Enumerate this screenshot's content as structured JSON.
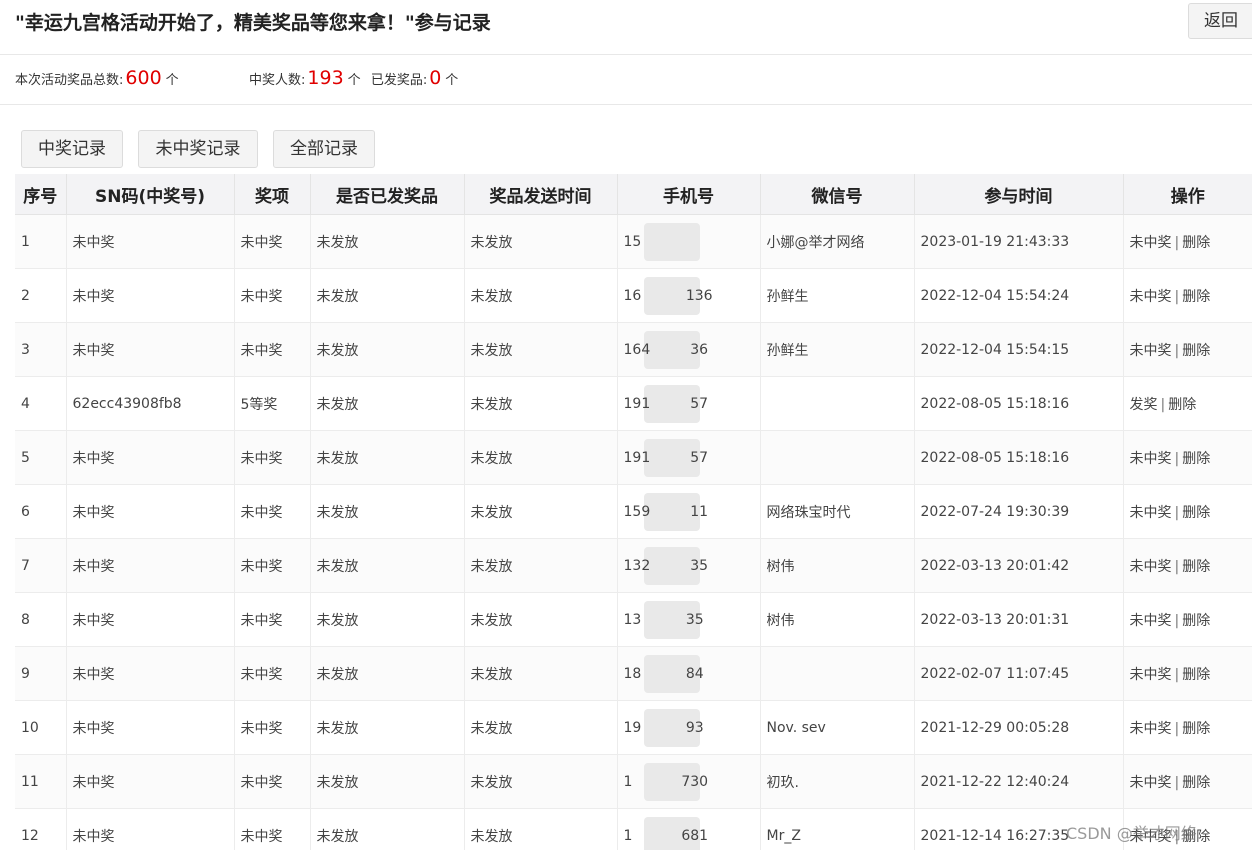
{
  "header": {
    "title": "\"幸运九宫格活动开始了，精美奖品等您来拿！\"参与记录",
    "back_label": "返回"
  },
  "stats": {
    "total_label": "本次活动奖品总数:",
    "total_value": "600",
    "unit": "个",
    "winners_label": "中奖人数:",
    "winners_value": "193",
    "issued_label": "已发奖品:",
    "issued_value": "0"
  },
  "tabs": [
    {
      "label": "中奖记录"
    },
    {
      "label": "未中奖记录"
    },
    {
      "label": "全部记录"
    }
  ],
  "table": {
    "headers": [
      "序号",
      "SN码(中奖号)",
      "奖项",
      "是否已发奖品",
      "奖品发送时间",
      "手机号",
      "微信号",
      "参与时间",
      "操作"
    ],
    "rows": [
      {
        "no": "1",
        "sn": "未中奖",
        "prize": "未中奖",
        "issued": "未发放",
        "send_time": "未发放",
        "phone": "15",
        "wechat": "小娜@举才网络",
        "time": "2023-01-19 21:43:33",
        "op": "未中奖",
        "del": "删除"
      },
      {
        "no": "2",
        "sn": "未中奖",
        "prize": "未中奖",
        "issued": "未发放",
        "send_time": "未发放",
        "phone": "16          136",
        "wechat": "孙鲜生",
        "time": "2022-12-04 15:54:24",
        "op": "未中奖",
        "del": "删除"
      },
      {
        "no": "3",
        "sn": "未中奖",
        "prize": "未中奖",
        "issued": "未发放",
        "send_time": "未发放",
        "phone": "164         36",
        "wechat": "孙鲜生",
        "time": "2022-12-04 15:54:15",
        "op": "未中奖",
        "del": "删除"
      },
      {
        "no": "4",
        "sn": "62ecc43908fb8",
        "prize": "5等奖",
        "issued": "未发放",
        "send_time": "未发放",
        "phone": "191         57",
        "wechat": "",
        "time": "2022-08-05 15:18:16",
        "op": "发奖",
        "del": "删除"
      },
      {
        "no": "5",
        "sn": "未中奖",
        "prize": "未中奖",
        "issued": "未发放",
        "send_time": "未发放",
        "phone": "191         57",
        "wechat": "",
        "time": "2022-08-05 15:18:16",
        "op": "未中奖",
        "del": "删除"
      },
      {
        "no": "6",
        "sn": "未中奖",
        "prize": "未中奖",
        "issued": "未发放",
        "send_time": "未发放",
        "phone": "159         11",
        "wechat": "网络珠宝时代",
        "time": "2022-07-24 19:30:39",
        "op": "未中奖",
        "del": "删除"
      },
      {
        "no": "7",
        "sn": "未中奖",
        "prize": "未中奖",
        "issued": "未发放",
        "send_time": "未发放",
        "phone": "132         35",
        "wechat": "树伟",
        "time": "2022-03-13 20:01:42",
        "op": "未中奖",
        "del": "删除"
      },
      {
        "no": "8",
        "sn": "未中奖",
        "prize": "未中奖",
        "issued": "未发放",
        "send_time": "未发放",
        "phone": "13          35",
        "wechat": "树伟",
        "time": "2022-03-13 20:01:31",
        "op": "未中奖",
        "del": "删除"
      },
      {
        "no": "9",
        "sn": "未中奖",
        "prize": "未中奖",
        "issued": "未发放",
        "send_time": "未发放",
        "phone": "18          84",
        "wechat": "",
        "time": "2022-02-07 11:07:45",
        "op": "未中奖",
        "del": "删除"
      },
      {
        "no": "10",
        "sn": "未中奖",
        "prize": "未中奖",
        "issued": "未发放",
        "send_time": "未发放",
        "phone": "19          93",
        "wechat": "Nov. sev",
        "time": "2021-12-29 00:05:28",
        "op": "未中奖",
        "del": "删除"
      },
      {
        "no": "11",
        "sn": "未中奖",
        "prize": "未中奖",
        "issued": "未发放",
        "send_time": "未发放",
        "phone": "1           730",
        "wechat": "初玖.",
        "time": "2021-12-22 12:40:24",
        "op": "未中奖",
        "del": "删除"
      },
      {
        "no": "12",
        "sn": "未中奖",
        "prize": "未中奖",
        "issued": "未发放",
        "send_time": "未发放",
        "phone": "1           681",
        "wechat": "Mr_Z",
        "time": "2021-12-14 16:27:35",
        "op": "未中奖",
        "del": "删除"
      }
    ]
  },
  "watermark": "CSDN @举才网络",
  "colors": {
    "accent_red": "#e00000",
    "header_bg": "#f3f3f5",
    "button_bg": "#f4f4f4"
  }
}
